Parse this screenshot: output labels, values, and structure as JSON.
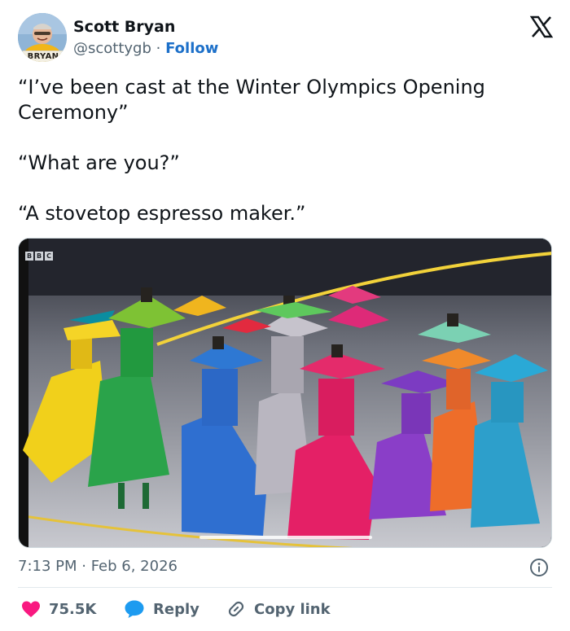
{
  "author": {
    "name": "Scott Bryan",
    "handle": "@scottygb",
    "separator": "·",
    "follow_label": "Follow",
    "avatar_badge": "BRYAN"
  },
  "tweet": {
    "paragraphs": [
      "“I’ve been cast at the Winter Olympics Opening Ceremony”",
      "“What are you?”",
      "“A stovetop espresso maker.”"
    ]
  },
  "media": {
    "watermark": [
      "B",
      "B",
      "C"
    ]
  },
  "meta": {
    "timestamp": "7:13 PM · Feb 6, 2026"
  },
  "actions": {
    "likes": "75.5K",
    "reply_label": "Reply",
    "copy_label": "Copy link"
  },
  "colors": {
    "like": "#f91880",
    "reply": "#1d9bf0",
    "follow": "#1d70c9",
    "text_secondary": "#536471"
  },
  "icons": {
    "brand": "x-logo-icon",
    "info": "info-icon",
    "like": "heart-icon",
    "reply": "speech-bubble-icon",
    "copy": "link-icon"
  }
}
